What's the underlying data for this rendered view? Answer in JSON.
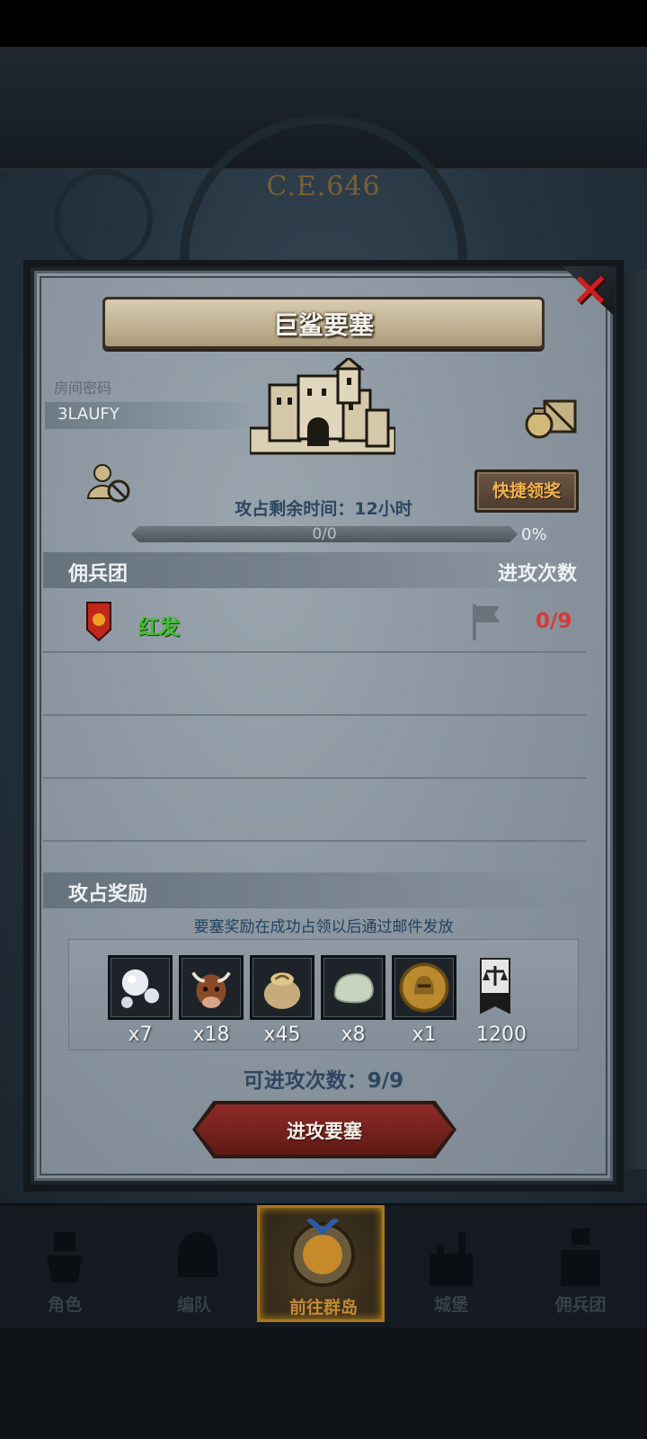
{
  "era_label": "C.E.646",
  "dialog": {
    "title": "巨鲨要塞",
    "room_code_label": "房间密码",
    "room_code": "3LAUFY",
    "quick_claim_label": "快捷领奖",
    "timer_text": "攻占剩余时间：12小时",
    "progress": {
      "text": "0/0",
      "percent_text": "0%",
      "fraction": 0.0
    },
    "mercenary_header": "佣兵团",
    "attack_count_header": "进攻次数",
    "mercenaries": [
      {
        "name": "红发",
        "attacks": "0/9",
        "color": "#3fbf2a"
      }
    ],
    "reward_header": "攻占奖励",
    "reward_note": "要塞奖励在成功占领以后通过邮件发放",
    "rewards": [
      {
        "icon": "pearl-icon",
        "count": "x7"
      },
      {
        "icon": "cattle-icon",
        "count": "x18"
      },
      {
        "icon": "grain-sack-icon",
        "count": "x45"
      },
      {
        "icon": "stone-icon",
        "count": "x8"
      },
      {
        "icon": "knight-coin-icon",
        "count": "x1"
      },
      {
        "icon": "justice-banner-icon",
        "count": "1200"
      }
    ],
    "attacks_available": "可进攻次数：9/9",
    "attack_button_label": "进攻要塞"
  },
  "nav": [
    {
      "label": "角色",
      "icon": "knight-icon"
    },
    {
      "label": "编队",
      "icon": "helmet-icon"
    },
    {
      "label": "前往群岛",
      "icon": "island-compass-icon",
      "active": true
    },
    {
      "label": "城堡",
      "icon": "castle-icon"
    },
    {
      "label": "佣兵团",
      "icon": "mercenary-icon"
    }
  ],
  "colors": {
    "accent_gold": "#f4b24a",
    "danger_red": "#d43a3a",
    "guild_green": "#3fbf2a"
  }
}
